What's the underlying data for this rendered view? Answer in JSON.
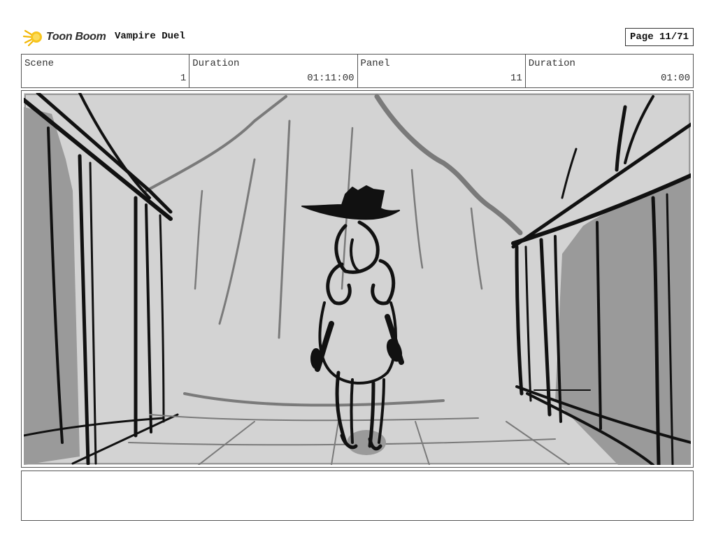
{
  "header": {
    "logo_text": "Toon Boom",
    "project_title": "Vampire Duel",
    "page_label": "Page 11/71"
  },
  "info": {
    "scene_label": "Scene",
    "scene_value": "1",
    "scene_duration_label": "Duration",
    "scene_duration_value": "01:11:00",
    "panel_label": "Panel",
    "panel_value": "11",
    "panel_duration_label": "Duration",
    "panel_duration_value": "01:00"
  },
  "notes": {
    "text": ""
  },
  "colors": {
    "sky": "#d3d3d3",
    "building_shadow": "#9a9a9a",
    "ink": "#111111",
    "mid_gray": "#7a7a7a"
  },
  "icons": {
    "logo": "toon-boom-star-logo"
  }
}
